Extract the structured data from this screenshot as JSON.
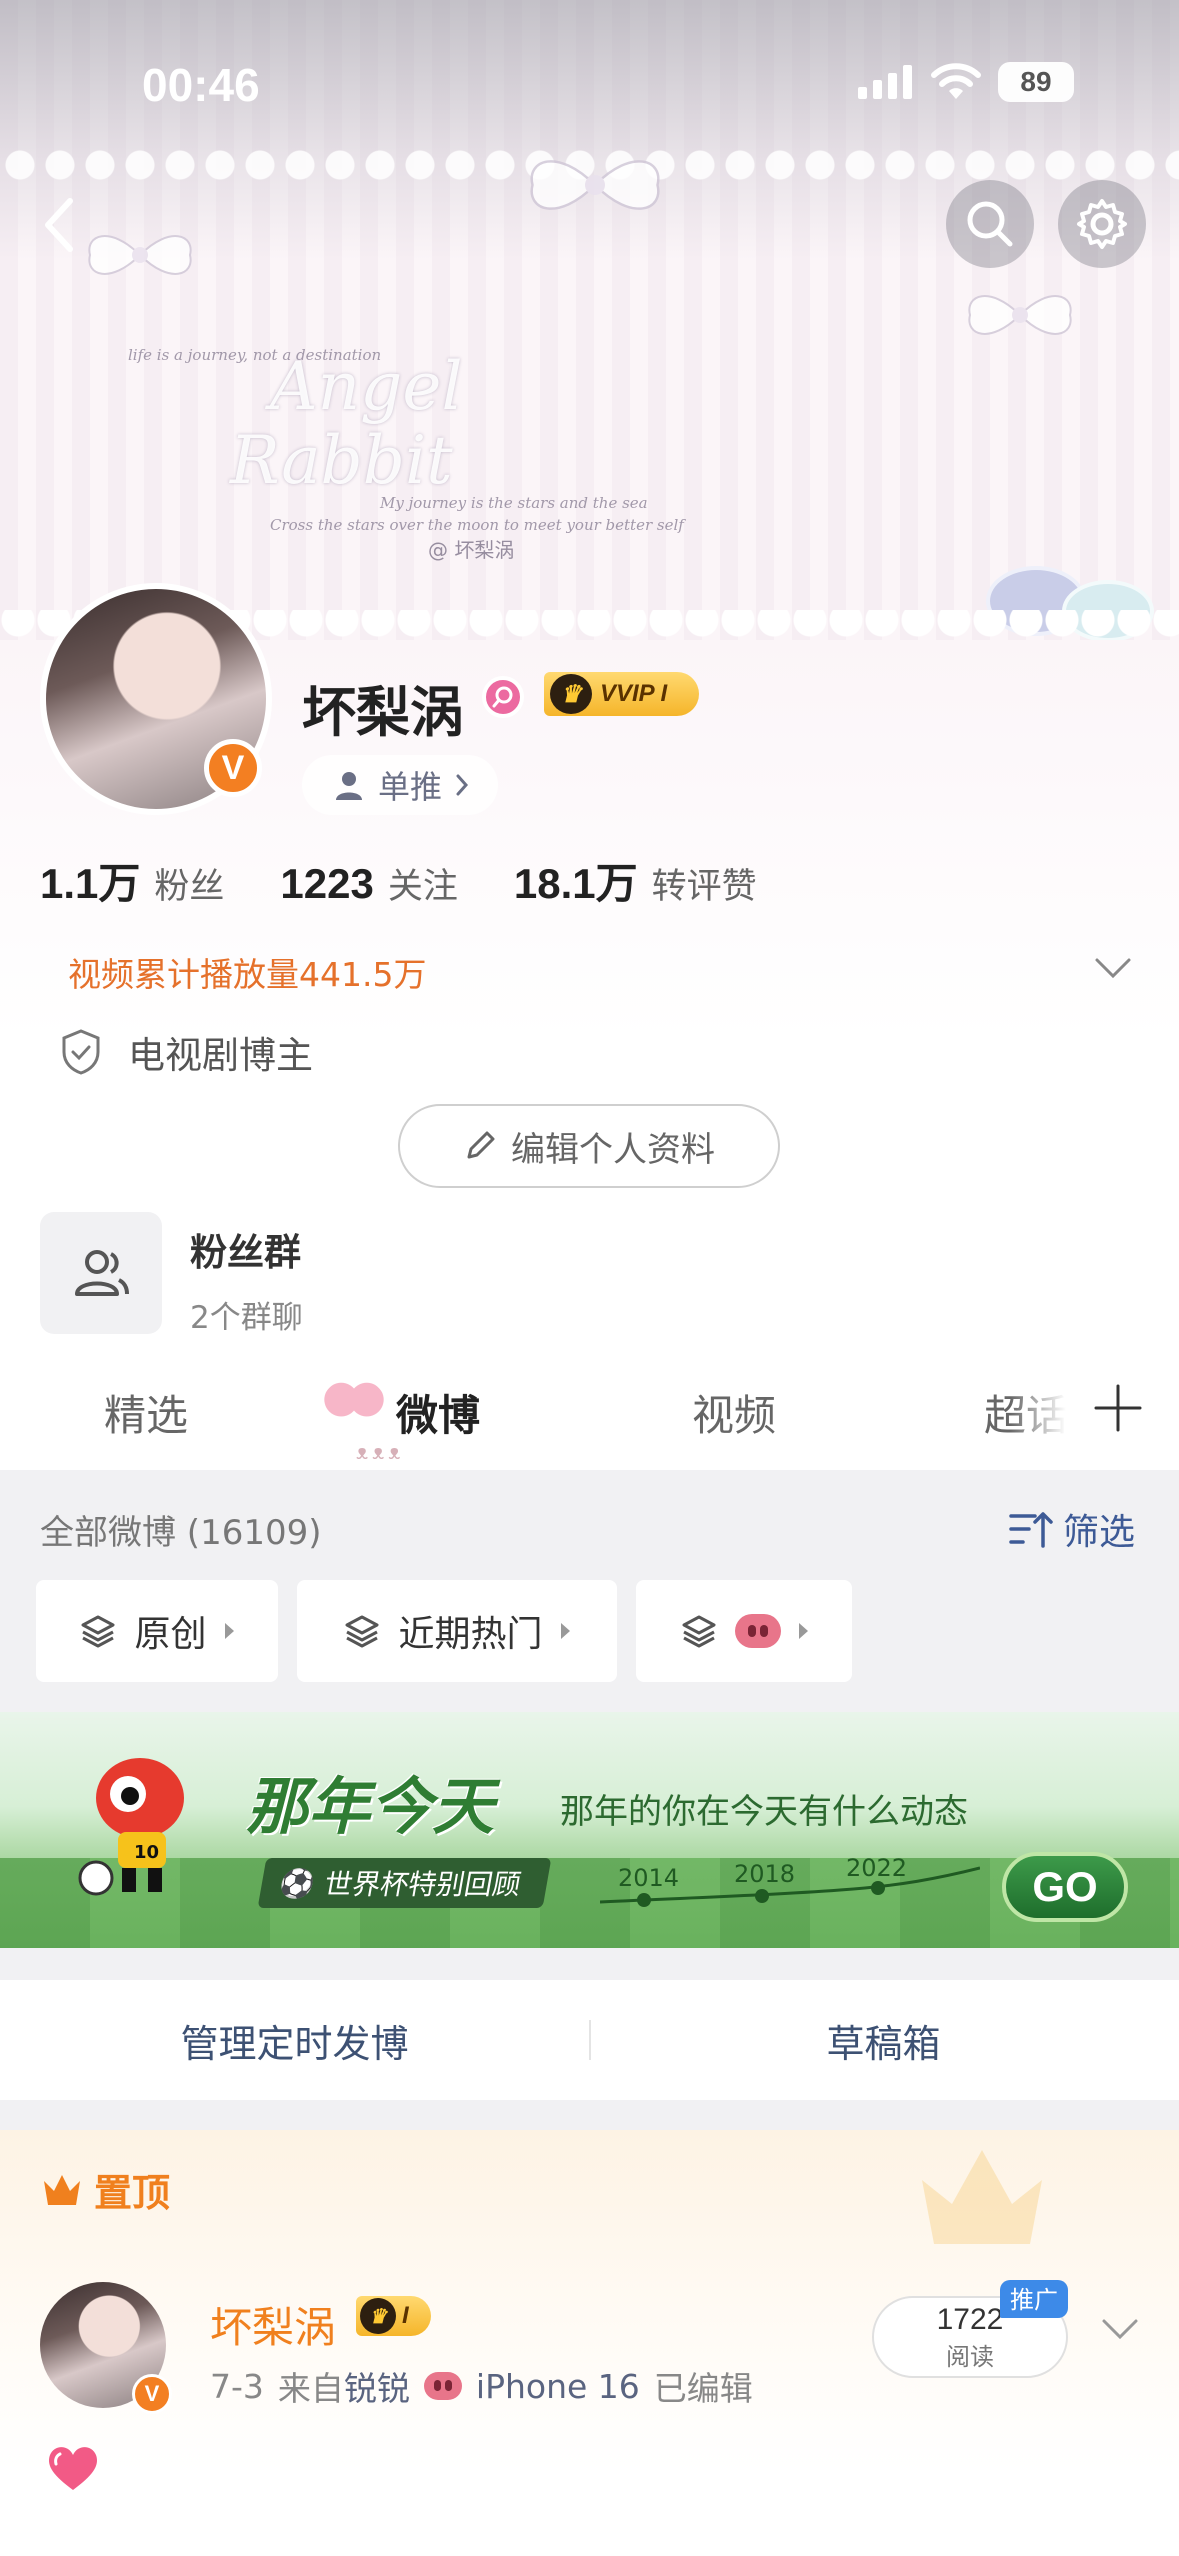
{
  "status_bar": {
    "time": "00:46",
    "battery": "89"
  },
  "banner": {
    "script_line1": "Angel",
    "script_line2": "Rabbit",
    "tagline_top": "life is a journey, not a destination",
    "tagline_mid": "My journey is the stars and the sea",
    "tagline_bot": "Cross the stars over the moon to meet your better self",
    "watermark": "@ 坏梨涡"
  },
  "profile": {
    "name": "坏梨涡",
    "vip_label": "VVIP I",
    "fan_tag": "单推",
    "stats": [
      {
        "value": "1.1万",
        "label": "粉丝"
      },
      {
        "value": "1223",
        "label": "关注"
      },
      {
        "value": "18.1万",
        "label": "转评赞"
      }
    ],
    "video_stat": "视频累计播放量441.5万",
    "tag": "电视剧博主",
    "edit_button": "编辑个人资料",
    "fan_group": {
      "title": "粉丝群",
      "subtitle": "2个群聊"
    }
  },
  "tabs": [
    {
      "label": "精选",
      "active": false
    },
    {
      "label": "微博",
      "active": true
    },
    {
      "label": "视频",
      "active": false
    },
    {
      "label": "超话",
      "active": false
    }
  ],
  "feed": {
    "all_label": "全部微博 (16109)",
    "filter_label": "筛选",
    "chips": [
      {
        "label": "原创"
      },
      {
        "label": "近期热门"
      }
    ]
  },
  "promo": {
    "title": "那年今天",
    "subtitle": "那年的你在今天有什么动态",
    "pill": "世界杯特别回顾",
    "years": [
      "2014",
      "2018",
      "2022"
    ],
    "go": "GO"
  },
  "actions": {
    "scheduled": "管理定时发博",
    "drafts": "草稿箱"
  },
  "pinned": {
    "label": "置顶",
    "author": "坏梨涡",
    "vip_label": "I",
    "date": "7-3",
    "source_prefix": "来自",
    "source_a": "锐锐",
    "source_b": "iPhone 16",
    "edited": "已编辑",
    "reads": "1722",
    "reads_label": "阅读",
    "promote_tag": "推广"
  },
  "colors": {
    "orange": "#f0801e",
    "link_blue": "#3d5a96",
    "vip_gold": "#f5b52a"
  }
}
